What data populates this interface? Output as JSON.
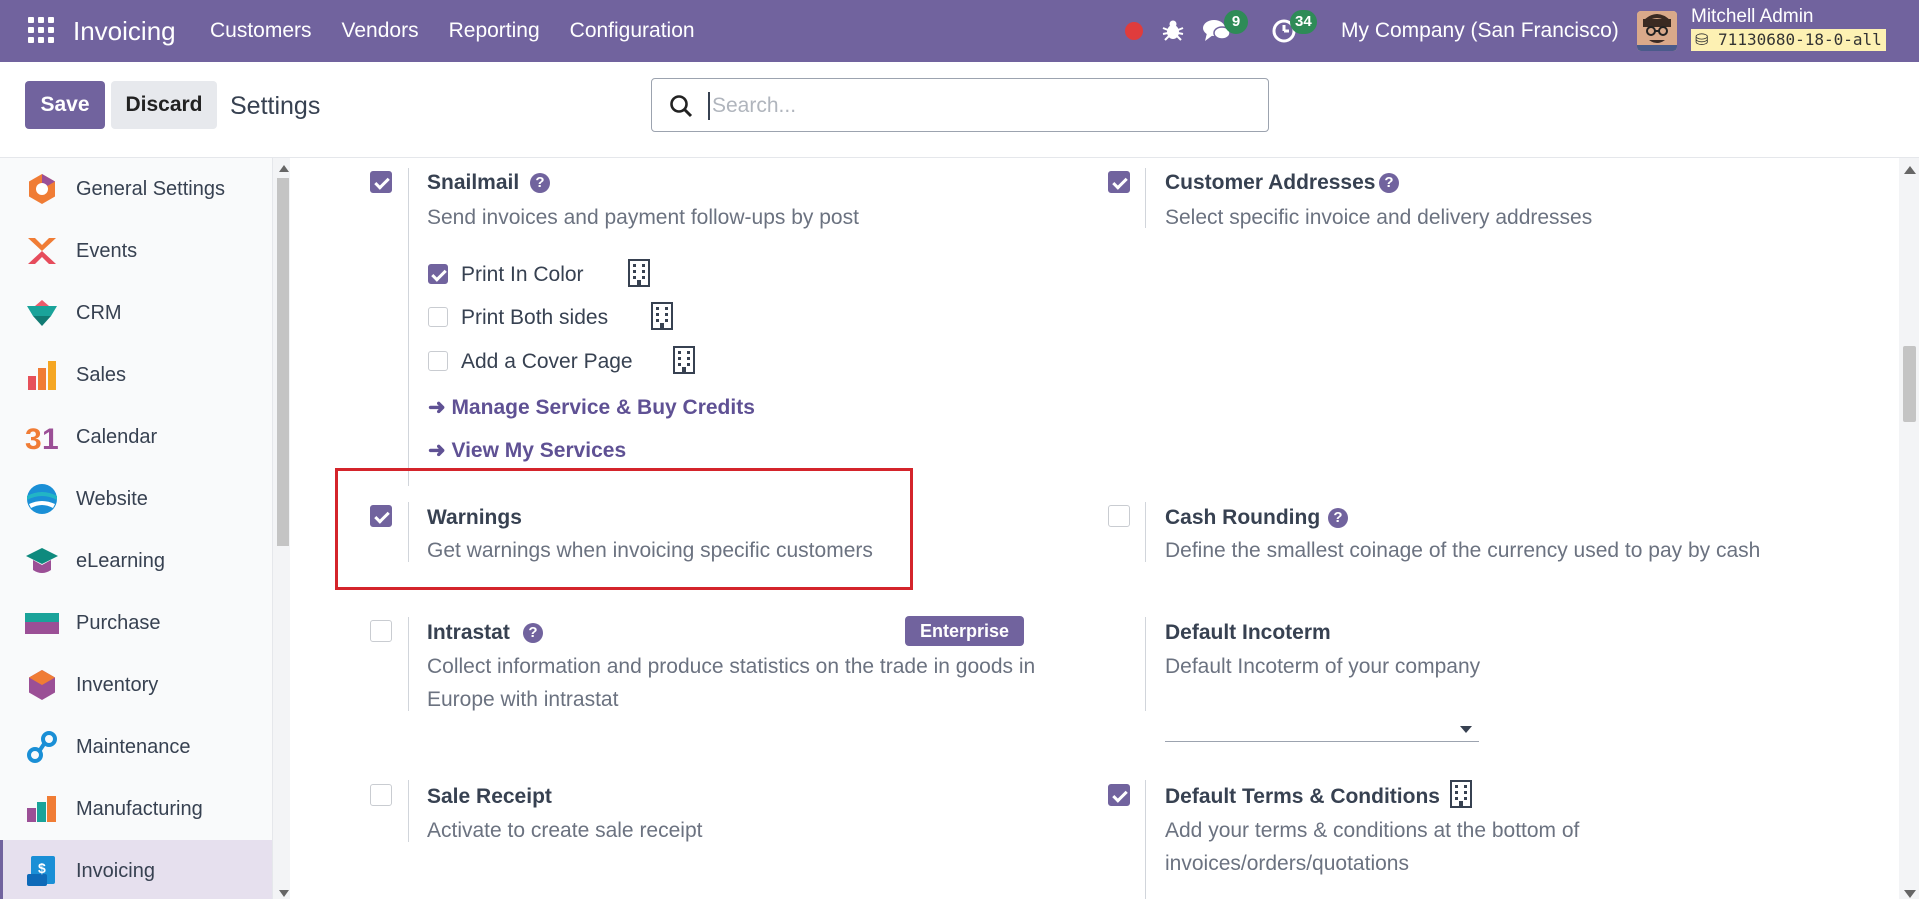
{
  "navbar": {
    "app_name": "Invoicing",
    "menu": [
      "Customers",
      "Vendors",
      "Reporting",
      "Configuration"
    ],
    "chat_count": "9",
    "activity_count": "34",
    "company": "My Company (San Francisco)",
    "user_name": "Mitchell Admin",
    "db_name": "71130680-18-0-all",
    "accent_color": "#71639e"
  },
  "control": {
    "save_label": "Save",
    "discard_label": "Discard",
    "title": "Settings",
    "search_placeholder": "Search..."
  },
  "sidebar": {
    "items": [
      {
        "label": "General Settings",
        "icon": "general-settings-icon"
      },
      {
        "label": "Events",
        "icon": "events-icon"
      },
      {
        "label": "CRM",
        "icon": "crm-icon"
      },
      {
        "label": "Sales",
        "icon": "sales-icon"
      },
      {
        "label": "Calendar",
        "icon": "calendar-icon"
      },
      {
        "label": "Website",
        "icon": "website-icon"
      },
      {
        "label": "eLearning",
        "icon": "elearning-icon"
      },
      {
        "label": "Purchase",
        "icon": "purchase-icon"
      },
      {
        "label": "Inventory",
        "icon": "inventory-icon"
      },
      {
        "label": "Maintenance",
        "icon": "maintenance-icon"
      },
      {
        "label": "Manufacturing",
        "icon": "manufacturing-icon"
      },
      {
        "label": "Invoicing",
        "icon": "invoicing-icon",
        "active": true
      }
    ]
  },
  "settings": {
    "snailmail": {
      "title": "Snailmail",
      "desc": "Send invoices and payment follow-ups by post",
      "checked": true,
      "options": [
        {
          "label": "Print In Color",
          "checked": true
        },
        {
          "label": "Print Both sides",
          "checked": false
        },
        {
          "label": "Add a Cover Page",
          "checked": false
        }
      ],
      "links": [
        "Manage Service & Buy Credits",
        "View My Services"
      ]
    },
    "customer_addresses": {
      "title": "Customer Addresses",
      "desc": "Select specific invoice and delivery addresses",
      "checked": true
    },
    "warnings": {
      "title": "Warnings",
      "desc": "Get warnings when invoicing specific customers",
      "checked": true
    },
    "cash_rounding": {
      "title": "Cash Rounding",
      "desc": "Define the smallest coinage of the currency used to pay by cash",
      "checked": false
    },
    "intrastat": {
      "title": "Intrastat",
      "desc": "Collect information and produce statistics on the trade in goods in Europe with intrastat",
      "checked": false,
      "badge": "Enterprise"
    },
    "default_incoterm": {
      "title": "Default Incoterm",
      "desc": "Default Incoterm of your company",
      "value": ""
    },
    "sale_receipt": {
      "title": "Sale Receipt",
      "desc": "Activate to create sale receipt",
      "checked": false
    },
    "default_terms": {
      "title": "Default Terms & Conditions",
      "desc": "Add your terms & conditions at the bottom of invoices/orders/quotations",
      "checked": true
    }
  }
}
